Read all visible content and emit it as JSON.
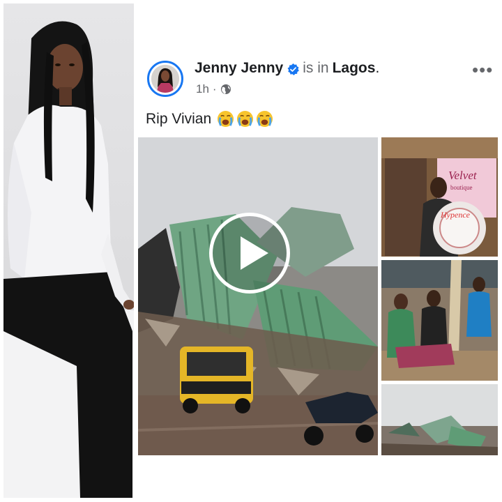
{
  "post": {
    "author": "Jenny Jenny",
    "is_in": "is in",
    "location": "Lagos",
    "period": ".",
    "time": "1h",
    "separator": "·",
    "privacy_icon": "globe-icon",
    "verified_icon": "verified-badge-icon",
    "more_label": "•••",
    "text": "Rip Vivian",
    "emojis": [
      "loudly-crying-face",
      "loudly-crying-face",
      "loudly-crying-face"
    ]
  },
  "media": {
    "main_video": "collapsed-building-video",
    "play_icon": "play-icon",
    "side_images": [
      "woman-holding-wreath-photo",
      "mourning-family-photo",
      "collapsed-building-photo"
    ]
  },
  "sign": {
    "line1": "Velvet",
    "line2": "boutique"
  },
  "wreath": {
    "text": "Hypence"
  },
  "colors": {
    "verified": "#1877f2",
    "text_primary": "#1c1e21",
    "text_secondary": "#65676b",
    "roof_green": "#5f9c76"
  }
}
